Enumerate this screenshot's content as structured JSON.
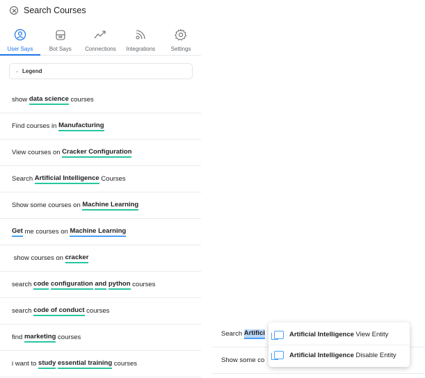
{
  "header": {
    "title": "Search Courses"
  },
  "tabs": [
    {
      "label": "User Says",
      "icon": "user-icon",
      "active": true
    },
    {
      "label": "Bot Says",
      "icon": "bot-icon",
      "active": false
    },
    {
      "label": "Connections",
      "icon": "connections-icon",
      "active": false
    },
    {
      "label": "Integrations",
      "icon": "integrations-icon",
      "active": false
    },
    {
      "label": "Settings",
      "icon": "settings-icon",
      "active": false
    }
  ],
  "legend": {
    "label": "Legend"
  },
  "utterances": [
    [
      {
        "t": "show "
      },
      {
        "t": "data science",
        "e": "g"
      },
      {
        "t": " courses"
      }
    ],
    [
      {
        "t": "Find courses in "
      },
      {
        "t": "Manufacturing",
        "e": "g"
      }
    ],
    [
      {
        "t": "View courses on "
      },
      {
        "t": "Cracker Configuration",
        "e": "g"
      }
    ],
    [
      {
        "t": "Search "
      },
      {
        "t": "Artificial Intelligence",
        "e": "g"
      },
      {
        "t": " Courses"
      }
    ],
    [
      {
        "t": "Show some courses on "
      },
      {
        "t": "Machine Learning",
        "e": "g"
      }
    ],
    [
      {
        "t": "Get",
        "e": "b"
      },
      {
        "t": " me courses on "
      },
      {
        "t": "Machine Learning",
        "e": "b"
      }
    ],
    [
      {
        "t": " show courses on "
      },
      {
        "t": "cracker",
        "e": "g"
      }
    ],
    [
      {
        "t": "search "
      },
      {
        "t": "code",
        "e": "g"
      },
      {
        "t": " "
      },
      {
        "t": "configuration",
        "e": "g"
      },
      {
        "t": " "
      },
      {
        "t": "and",
        "e": "g"
      },
      {
        "t": " "
      },
      {
        "t": "python",
        "e": "g"
      },
      {
        "t": " courses"
      }
    ],
    [
      {
        "t": "search "
      },
      {
        "t": "code of conduct",
        "e": "g"
      },
      {
        "t": " courses"
      }
    ],
    [
      {
        "t": "find "
      },
      {
        "t": "marketing",
        "e": "g"
      },
      {
        "t": " courses"
      }
    ],
    [
      {
        "t": "i want to "
      },
      {
        "t": "study",
        "e": "g"
      },
      {
        "t": " "
      },
      {
        "t": "essential training",
        "e": "g"
      },
      {
        "t": " courses"
      }
    ]
  ],
  "right_rows": {
    "row1_prefix": "Search ",
    "row1_highlight": "Artifici",
    "row2_prefix": "Show some co"
  },
  "context_menu": {
    "items": [
      {
        "entity": "Artificial Intelligence",
        "action": " View Entity"
      },
      {
        "entity": "Artificial Intelligence",
        "action": " Disable Entity"
      }
    ]
  },
  "colors": {
    "accent": "#1a73e8",
    "entity_green": "#26c6a0",
    "entity_blue": "#4a9ff5"
  }
}
